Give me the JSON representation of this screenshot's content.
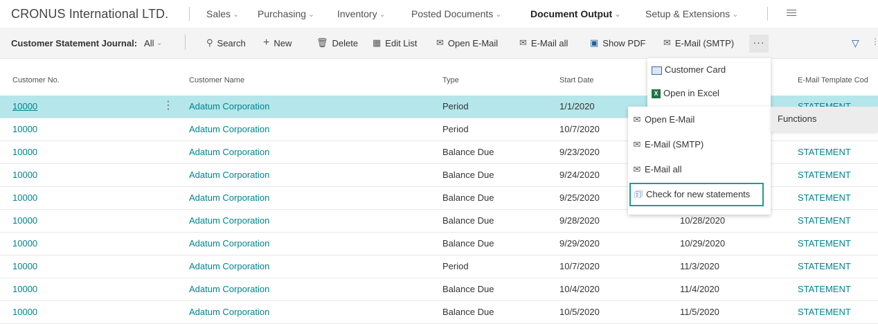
{
  "app": {
    "company": "CRONUS International LTD."
  },
  "nav": [
    {
      "label": "Sales"
    },
    {
      "label": "Purchasing"
    },
    {
      "label": "Inventory"
    },
    {
      "label": "Posted Documents"
    },
    {
      "label": "Document Output"
    },
    {
      "label": "Setup & Extensions"
    }
  ],
  "actionbar": {
    "journal_label": "Customer Statement Journal:",
    "journal_value": "All",
    "search": "Search",
    "new": "New",
    "delete": "Delete",
    "edit_list": "Edit List",
    "open_email": "Open E-Mail",
    "email_all": "E-Mail all",
    "show_pdf": "Show PDF",
    "email_smtp": "E-Mail (SMTP)",
    "more": "···"
  },
  "table": {
    "headers": [
      "Customer No.",
      "Customer Name",
      "Type",
      "Start Date",
      "E-Mail Template Cod"
    ],
    "rows": [
      {
        "no": "10000",
        "name": "Adatum Corporation",
        "type": "Period",
        "start": "1/1/2020",
        "end": "",
        "template": "STATEMENT"
      },
      {
        "no": "10000",
        "name": "Adatum Corporation",
        "type": "Period",
        "start": "10/7/2020",
        "end": "",
        "template": ""
      },
      {
        "no": "10000",
        "name": "Adatum Corporation",
        "type": "Balance Due",
        "start": "9/23/2020",
        "end": "",
        "template": "STATEMENT"
      },
      {
        "no": "10000",
        "name": "Adatum Corporation",
        "type": "Balance Due",
        "start": "9/24/2020",
        "end": "",
        "template": "STATEMENT"
      },
      {
        "no": "10000",
        "name": "Adatum Corporation",
        "type": "Balance Due",
        "start": "9/25/2020",
        "end": "",
        "template": "STATEMENT"
      },
      {
        "no": "10000",
        "name": "Adatum Corporation",
        "type": "Balance Due",
        "start": "9/28/2020",
        "end": "10/28/2020",
        "template": "STATEMENT"
      },
      {
        "no": "10000",
        "name": "Adatum Corporation",
        "type": "Balance Due",
        "start": "9/29/2020",
        "end": "10/29/2020",
        "template": "STATEMENT"
      },
      {
        "no": "10000",
        "name": "Adatum Corporation",
        "type": "Period",
        "start": "10/7/2020",
        "end": "11/3/2020",
        "template": "STATEMENT"
      },
      {
        "no": "10000",
        "name": "Adatum Corporation",
        "type": "Balance Due",
        "start": "10/4/2020",
        "end": "11/4/2020",
        "template": "STATEMENT"
      },
      {
        "no": "10000",
        "name": "Adatum Corporation",
        "type": "Balance Due",
        "start": "10/5/2020",
        "end": "11/5/2020",
        "template": "STATEMENT"
      }
    ]
  },
  "more_menu": {
    "items": [
      "Customer Card",
      "Open in Excel"
    ]
  },
  "functions_menu": {
    "label": "Functions",
    "items": [
      "Open E-Mail",
      "E-Mail (SMTP)",
      "E-Mail all",
      "Check for new statements"
    ]
  },
  "colors": {
    "accent": "#00838f",
    "selected_row": "#b5e6ea",
    "highlight_border": "#1e9e8a"
  }
}
